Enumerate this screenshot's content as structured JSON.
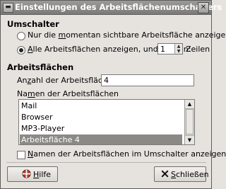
{
  "window": {
    "title": "Einstellungen des Arbeitsflächenumschalters",
    "menu_glyph": "▬",
    "close_glyph": "✕"
  },
  "umschalter": {
    "title": "Umschalter",
    "option_current_pre": "Nur die ",
    "option_current_u": "m",
    "option_current_post": "omentan sichtbare Arbeitsfläche anzeigen",
    "option_current_selected": false,
    "option_all_u": "A",
    "option_all_post": "lle Arbeitsflächen anzeigen, und zwar in:",
    "option_all_selected": true,
    "rows_value": "1",
    "rows_unit": "Zeilen"
  },
  "arbeitsflaechen": {
    "title": "Arbeitsflächen",
    "count_label_pre": "An",
    "count_label_u": "z",
    "count_label_post": "ahl der Arbeitsflächen:",
    "count_value": "4",
    "names_label_pre": "Na",
    "names_label_u": "m",
    "names_label_post": "en der Arbeitsflächen",
    "names": [
      "Mail",
      "Browser",
      "MP3-Player",
      "Arbeitsfläche 4"
    ],
    "selected_index": 3,
    "show_names_checked": false,
    "show_names_u": "N",
    "show_names_post": "amen der Arbeitsflächen im Umschalter anzeigen"
  },
  "buttons": {
    "help_u": "H",
    "help_post": "ilfe",
    "close_u": "S",
    "close_post": "chließen"
  }
}
